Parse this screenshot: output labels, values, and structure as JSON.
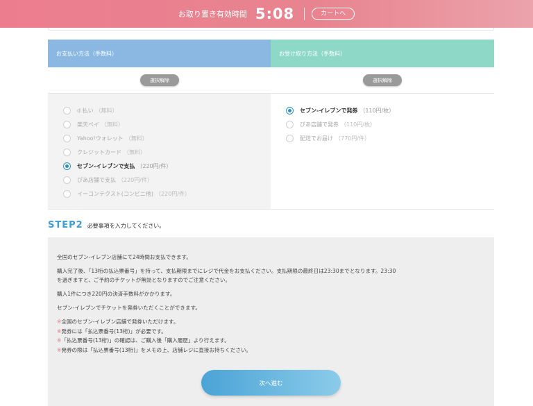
{
  "header": {
    "label": "お取り置き有効時間",
    "timer": "5:08",
    "cart_button": "カートへ"
  },
  "payment": {
    "heading": "お支払い方法（手数料）",
    "clear_button": "選択解除",
    "options": [
      {
        "name": "d 払い",
        "fee": "（無料）",
        "selected": false
      },
      {
        "name": "楽天ペイ",
        "fee": "（無料）",
        "selected": false
      },
      {
        "name": "Yahoo!ウォレット",
        "fee": "（無料）",
        "selected": false
      },
      {
        "name": "クレジットカード",
        "fee": "（無料）",
        "selected": false
      },
      {
        "name": "セブン-イレブンで支払",
        "fee": "（220円/件）",
        "selected": true
      },
      {
        "name": "ぴあ店舗で支払",
        "fee": "（220円/件）",
        "selected": false
      },
      {
        "name": "イーコンテクスト(コンビニ他)",
        "fee": "（220円/件）",
        "selected": false
      }
    ]
  },
  "delivery": {
    "heading": "お受け取り方法（手数料）",
    "clear_button": "選択解除",
    "options": [
      {
        "name": "セブン-イレブンで発券",
        "fee": "（110円/枚）",
        "selected": true
      },
      {
        "name": "ぴあ店舗で発券",
        "fee": "（110円/枚）",
        "selected": false
      },
      {
        "name": "配送でお届け",
        "fee": "（770円/件）",
        "selected": false
      }
    ]
  },
  "step2": {
    "label": "STEP2",
    "text": "必要事項を入力してください。"
  },
  "info": {
    "p1": "全国のセブン-イレブン店舗にて24時間お支払できます。",
    "p2a": "購入完了後、「13桁の払込票番号」を持って、支払期限までにレジで代金をお支払ください。支払期限の最終日は23:30までとなります。23:30",
    "p2b": "を過ぎますと、ご予約のチケットが無効となりますのでご注意ください。",
    "p3": "購入1件につき220円の決済手数料がかかります。",
    "p4": "セブン-イレブンでチケットを発券いただくことができます。",
    "mark": "※",
    "notes": [
      "全国のセブン-イレブン店舗で発券いただけます。",
      "発券には「払込票番号(13桁)」が必要です。",
      "「払込票番号(13桁)」の確認は、ご購入後「購入履歴」より行えます。",
      "発券の際は「払込票番号(13桁)」をメモの上、店舗レジに直接お持ちください。"
    ]
  },
  "next_button": "次へ進む"
}
